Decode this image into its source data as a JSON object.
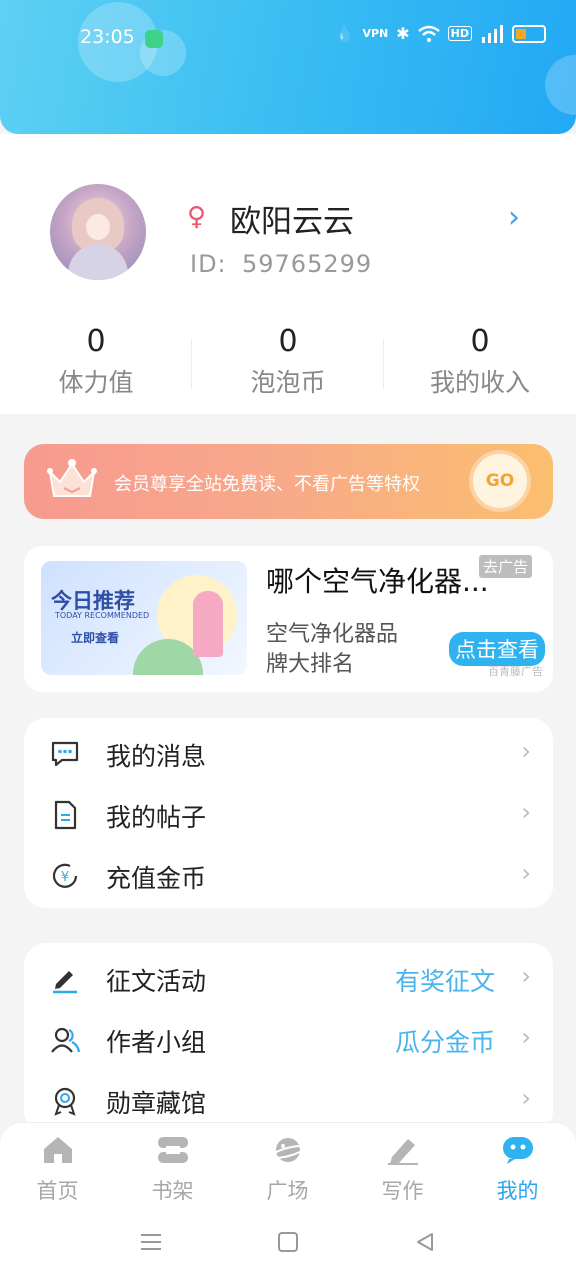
{
  "status_bar": {
    "time": "23:05",
    "icons": [
      "water-drop-icon",
      "vpn-icon",
      "bluetooth-icon",
      "wifi-icon",
      "hd-icon",
      "signal-5g-icon",
      "battery-icon"
    ]
  },
  "profile": {
    "nickname": "欧阳云云",
    "gender_icon": "female-icon",
    "id_label": "ID:",
    "id_value": "59765299",
    "stats": [
      {
        "value": "0",
        "label": "体力值"
      },
      {
        "value": "0",
        "label": "泡泡币"
      },
      {
        "value": "0",
        "label": "我的收入"
      }
    ]
  },
  "vip_banner": {
    "text": "会员尊享全站免费读、不看广告等特权",
    "button": "GO"
  },
  "ad": {
    "image_title": "今日推荐",
    "image_subtitle": "TODAY RECOMMENDED",
    "image_cta": "立即查看",
    "title": "哪个空气净化器...",
    "tag": "去广告",
    "description_line1": "空气净化器品",
    "description_line2": "牌大排名",
    "button": "点击查看",
    "source": "百青藤广告"
  },
  "menu1": [
    {
      "label": "我的消息",
      "icon": "message-icon"
    },
    {
      "label": "我的帖子",
      "icon": "document-icon"
    },
    {
      "label": "充值金币",
      "icon": "yuan-coin-icon"
    }
  ],
  "menu2": [
    {
      "label": "征文活动",
      "extra": "有奖征文",
      "icon": "pen-icon"
    },
    {
      "label": "作者小组",
      "extra": "瓜分金币",
      "icon": "group-icon"
    },
    {
      "label": "勋章藏馆",
      "extra": "",
      "icon": "medal-icon"
    }
  ],
  "tabs": [
    {
      "label": "首页",
      "icon": "home-icon"
    },
    {
      "label": "书架",
      "icon": "bookshelf-icon"
    },
    {
      "label": "广场",
      "icon": "planet-icon"
    },
    {
      "label": "写作",
      "icon": "write-icon"
    },
    {
      "label": "我的",
      "icon": "profile-bot-icon",
      "active": true
    }
  ],
  "colors": {
    "accent": "#28a6f0",
    "header_start": "#5fd0f3",
    "header_end": "#22a8f5",
    "vip_start": "#f79a8f",
    "vip_end": "#fbbf6f"
  }
}
